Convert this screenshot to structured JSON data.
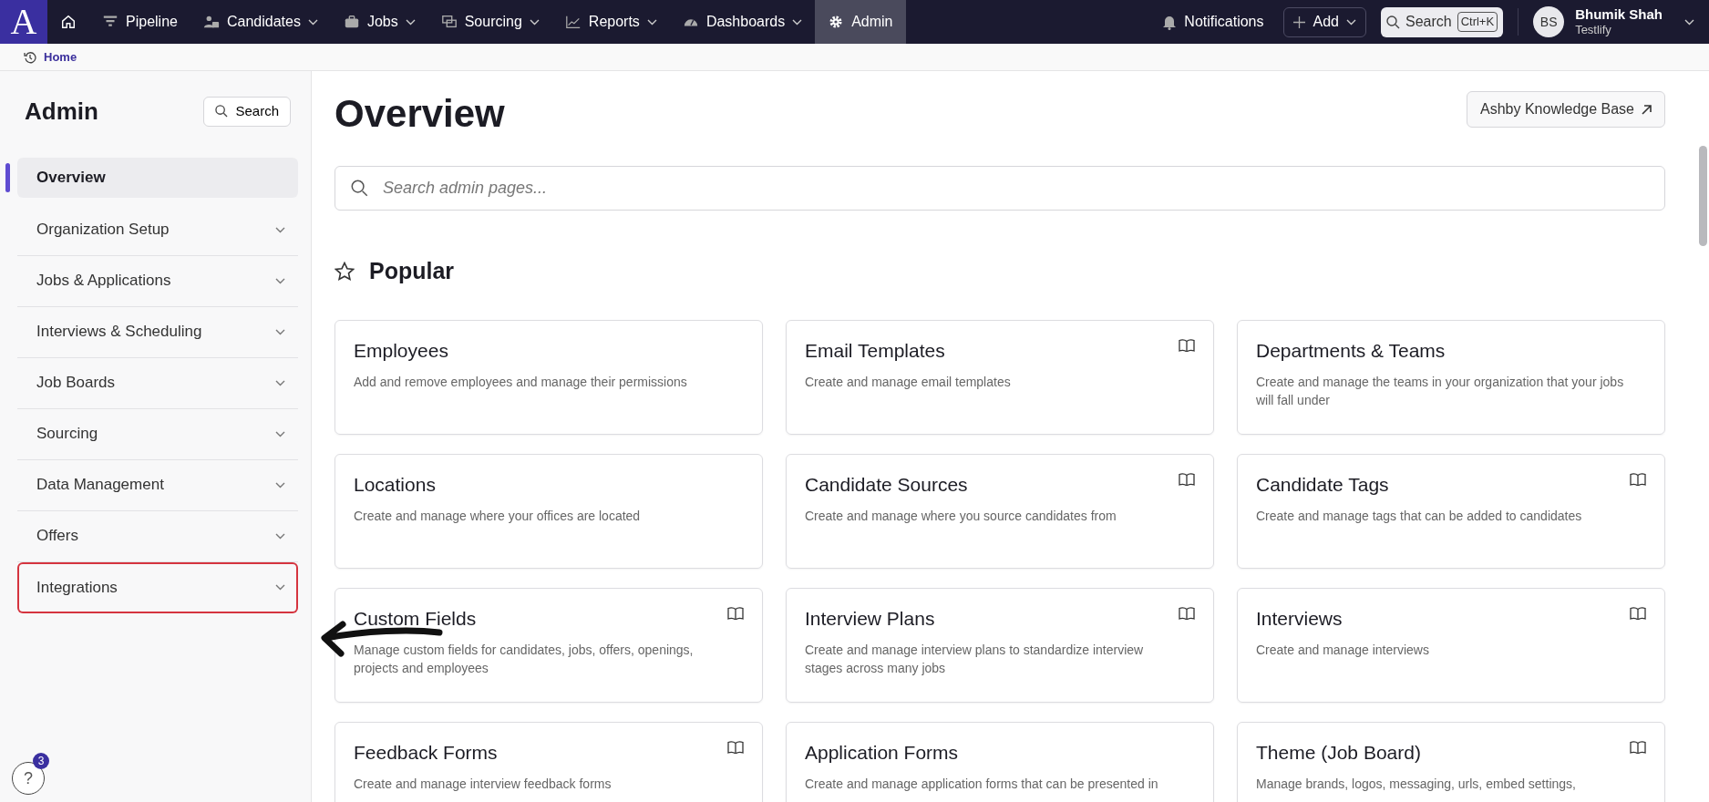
{
  "topbar": {
    "logo": "A",
    "nav": [
      {
        "label": "Pipeline",
        "dropdown": false,
        "selected": false
      },
      {
        "label": "Candidates",
        "dropdown": true,
        "selected": false
      },
      {
        "label": "Jobs",
        "dropdown": true,
        "selected": false
      },
      {
        "label": "Sourcing",
        "dropdown": true,
        "selected": false
      },
      {
        "label": "Reports",
        "dropdown": true,
        "selected": false
      },
      {
        "label": "Dashboards",
        "dropdown": true,
        "selected": false
      },
      {
        "label": "Admin",
        "dropdown": false,
        "selected": true
      }
    ],
    "notifications": "Notifications",
    "add": "Add",
    "search": "Search",
    "shortcut": "Ctrl+K",
    "user": {
      "initials": "BS",
      "name": "Bhumik Shah",
      "org": "Testlify"
    }
  },
  "breadcrumb": "Home",
  "sidebar": {
    "title": "Admin",
    "search": "Search",
    "items": [
      {
        "label": "Overview",
        "expandable": false,
        "selected": true,
        "highlighted": false
      },
      {
        "label": "Organization Setup",
        "expandable": true,
        "selected": false,
        "highlighted": false
      },
      {
        "label": "Jobs & Applications",
        "expandable": true,
        "selected": false,
        "highlighted": false
      },
      {
        "label": "Interviews & Scheduling",
        "expandable": true,
        "selected": false,
        "highlighted": false
      },
      {
        "label": "Job Boards",
        "expandable": true,
        "selected": false,
        "highlighted": false
      },
      {
        "label": "Sourcing",
        "expandable": true,
        "selected": false,
        "highlighted": false
      },
      {
        "label": "Data Management",
        "expandable": true,
        "selected": false,
        "highlighted": false
      },
      {
        "label": "Offers",
        "expandable": true,
        "selected": false,
        "highlighted": false
      },
      {
        "label": "Integrations",
        "expandable": true,
        "selected": false,
        "highlighted": true
      }
    ],
    "help": {
      "label": "?",
      "badge": "3"
    }
  },
  "main": {
    "title": "Overview",
    "kb_button": "Ashby Knowledge Base",
    "search_placeholder": "Search admin pages...",
    "section": "Popular",
    "cards": [
      {
        "title": "Employees",
        "description": "Add and remove employees and manage their permissions",
        "guide": false
      },
      {
        "title": "Email Templates",
        "description": "Create and manage email templates",
        "guide": true
      },
      {
        "title": "Departments & Teams",
        "description": "Create and manage the teams in your organization that your jobs will fall under",
        "guide": false
      },
      {
        "title": "Locations",
        "description": "Create and manage where your offices are located",
        "guide": false
      },
      {
        "title": "Candidate Sources",
        "description": "Create and manage where you source candidates from",
        "guide": true
      },
      {
        "title": "Candidate Tags",
        "description": "Create and manage tags that can be added to candidates",
        "guide": true
      },
      {
        "title": "Custom Fields",
        "description": "Manage custom fields for candidates, jobs, offers, openings, projects and employees",
        "guide": true
      },
      {
        "title": "Interview Plans",
        "description": "Create and manage interview plans to standardize interview stages across many jobs",
        "guide": true
      },
      {
        "title": "Interviews",
        "description": "Create and manage interviews",
        "guide": true
      },
      {
        "title": "Feedback Forms",
        "description": "Create and manage interview feedback forms",
        "guide": true
      },
      {
        "title": "Application Forms",
        "description": "Create and manage application forms that can be presented in",
        "guide": false
      },
      {
        "title": "Theme (Job Board)",
        "description": "Manage brands, logos, messaging, urls, embed settings,",
        "guide": true
      }
    ]
  }
}
